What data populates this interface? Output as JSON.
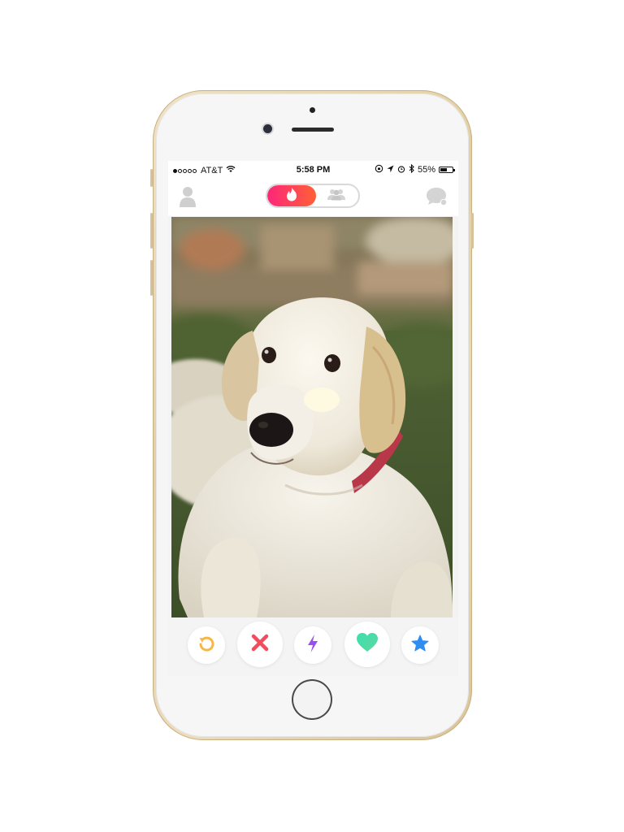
{
  "status_bar": {
    "carrier": "AT&T",
    "time": "5:58 PM",
    "battery_percent": "55%",
    "battery_level": 0.55,
    "signal_bars_filled": 1,
    "signal_bars_total": 5,
    "icons": [
      "wifi-icon",
      "lock-rotation-icon",
      "location-arrow-icon",
      "alarm-icon",
      "bluetooth-icon",
      "battery-icon"
    ]
  },
  "nav": {
    "left_icon": "profile-icon",
    "right_icon": "messages-icon",
    "toggle": {
      "active": "flame-icon",
      "inactive": "group-icon",
      "active_colors": [
        "#fd267a",
        "#ff6036"
      ]
    }
  },
  "card": {
    "photo_subject": "golden-retriever-photo"
  },
  "actions": {
    "buttons": [
      {
        "icon": "rewind-icon",
        "color": "#f5b748"
      },
      {
        "icon": "nope-x-icon",
        "color": "#f04e5e"
      },
      {
        "icon": "boost-lightning-icon",
        "color": "#9b4ff0"
      },
      {
        "icon": "like-heart-icon",
        "color": "#3ddfaa"
      },
      {
        "icon": "super-like-star-icon",
        "color": "#2f8cf3"
      }
    ]
  },
  "device": {
    "body_color": "#e6d3aa",
    "model": "iphone-gold"
  }
}
